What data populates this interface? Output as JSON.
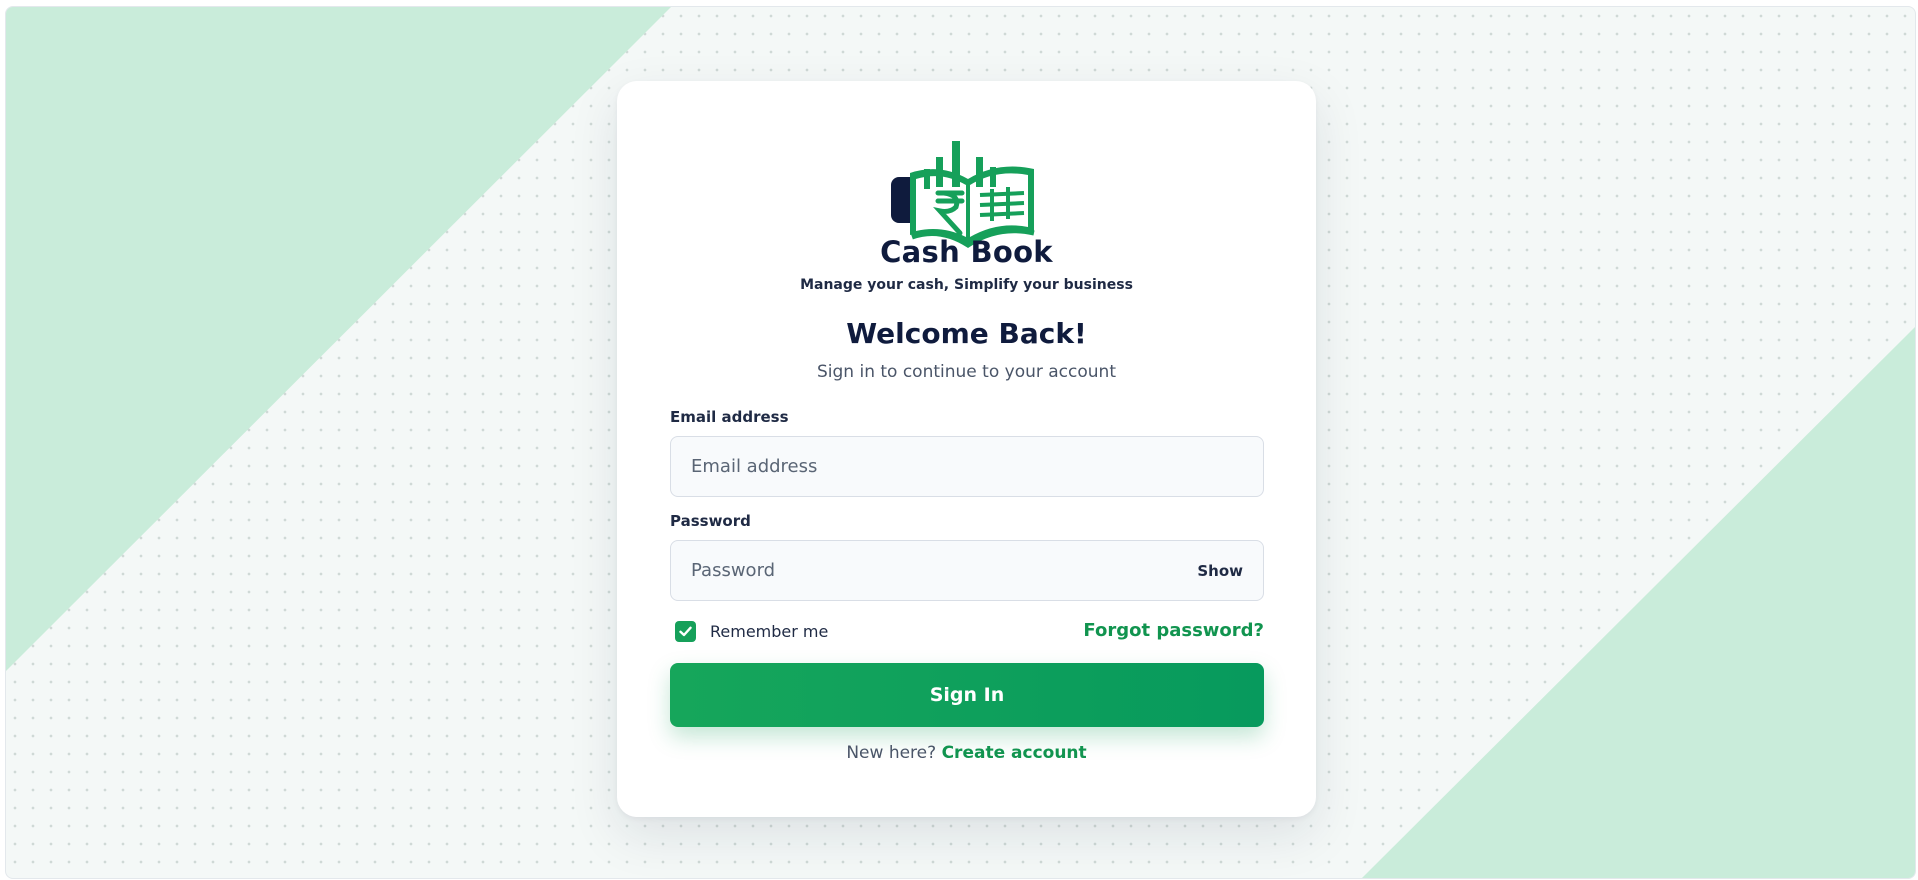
{
  "colors": {
    "accent": "#16a05a",
    "accent_dark": "#079a5d",
    "navy": "#0f1b3d",
    "background_mint": "#c9ecda"
  },
  "brand": {
    "logo_icon": "cash-book-logo-icon",
    "name": "Cash Book",
    "tagline": "Manage your cash, Simplify your business"
  },
  "form": {
    "heading": "Welcome Back!",
    "subheading": "Sign in to continue to your account",
    "email": {
      "label": "Email address",
      "placeholder": "Email address",
      "value": ""
    },
    "password": {
      "label": "Password",
      "placeholder": "Password",
      "value": "",
      "toggle_label": "Show"
    },
    "remember": {
      "label": "Remember me",
      "checked": true
    },
    "forgot_label": "Forgot password?",
    "submit_label": "Sign In",
    "signup_prompt": "New here?",
    "signup_link": "Create account"
  }
}
